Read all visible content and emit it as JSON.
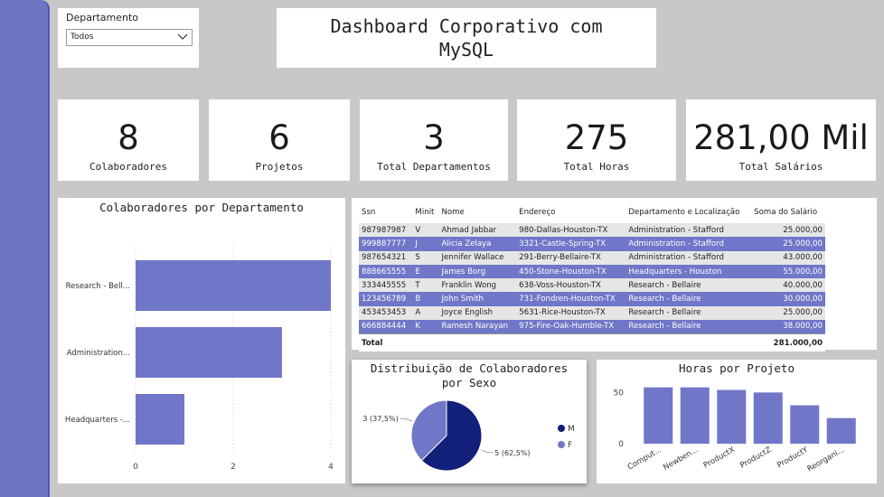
{
  "slicer": {
    "label": "Departamento",
    "value": "Todos"
  },
  "title": "Dashboard Corporativo com MySQL",
  "kpis": [
    {
      "value": "8",
      "label": "Colaboradores"
    },
    {
      "value": "6",
      "label": "Projetos"
    },
    {
      "value": "3",
      "label": "Total Departamentos"
    },
    {
      "value": "275",
      "label": "Total Horas"
    },
    {
      "value": "281,00 Mil",
      "label": "Total Salários"
    }
  ],
  "bar_chart": {
    "title": "Colaboradores por Departamento"
  },
  "table": {
    "headers": [
      "Ssn",
      "Minit",
      "Nome",
      "Endereço",
      "Departamento e Localização",
      "Soma do Salário"
    ],
    "rows": [
      [
        "987987987",
        "V",
        "Ahmad Jabbar",
        "980-Dallas-Houston-TX",
        "Administration - Stafford",
        "25.000,00"
      ],
      [
        "999887777",
        "J",
        "Alicia Zelaya",
        "3321-Castle-Spring-TX",
        "Administration - Stafford",
        "25.000,00"
      ],
      [
        "987654321",
        "S",
        "Jennifer Wallace",
        "291-Berry-Bellaire-TX",
        "Administration - Stafford",
        "43.000,00"
      ],
      [
        "888665555",
        "E",
        "James Borg",
        "450-Stone-Houston-TX",
        "Headquarters - Houston",
        "55.000,00"
      ],
      [
        "333445555",
        "T",
        "Franklin Wong",
        "638-Voss-Houston-TX",
        "Research - Bellaire",
        "40.000,00"
      ],
      [
        "123456789",
        "B",
        "John Smith",
        "731-Fondren-Houston-TX",
        "Research - Bellaire",
        "30.000,00"
      ],
      [
        "453453453",
        "A",
        "Joyce English",
        "5631-Rice-Houston-TX",
        "Research - Bellaire",
        "25.000,00"
      ],
      [
        "666884444",
        "K",
        "Ramesh Narayan",
        "975-Fire-Oak-Humble-TX",
        "Research - Bellaire",
        "38.000,00"
      ]
    ],
    "total_label": "Total",
    "total_value": "281.000,00"
  },
  "pie_chart": {
    "title_line1": "Distribuição de Colaboradores",
    "title_line2": "por Sexo"
  },
  "col_chart": {
    "title": "Horas por Projeto"
  },
  "colors": {
    "accent": "#6e75c4",
    "dark": "#13207a",
    "light": "#7076c8"
  },
  "chart_data": [
    {
      "type": "bar",
      "orientation": "horizontal",
      "title": "Colaboradores por Departamento",
      "categories": [
        "Research - Bell...",
        "Administration...",
        "Headquarters -..."
      ],
      "values": [
        4,
        3,
        1
      ],
      "xlim": [
        0,
        4
      ],
      "xticks": [
        "0",
        "2",
        "4"
      ],
      "grid": true
    },
    {
      "type": "pie",
      "title": "Distribuição de Colaboradores por Sexo",
      "series": [
        {
          "name": "M",
          "value": 5,
          "label": "5 (62,5%)",
          "color": "#13207a"
        },
        {
          "name": "F",
          "value": 3,
          "label": "3 (37,5%)",
          "color": "#7076c8"
        }
      ],
      "legend": "right"
    },
    {
      "type": "bar",
      "orientation": "vertical",
      "title": "Horas por Projeto",
      "categories": [
        "Comput...",
        "Newben...",
        "ProductX",
        "ProductZ",
        "ProductY",
        "Reorgani..."
      ],
      "values": [
        55,
        55,
        52.5,
        50,
        37.5,
        25
      ],
      "ylim": [
        0,
        60
      ],
      "yticks": [
        "0",
        "50"
      ]
    }
  ]
}
